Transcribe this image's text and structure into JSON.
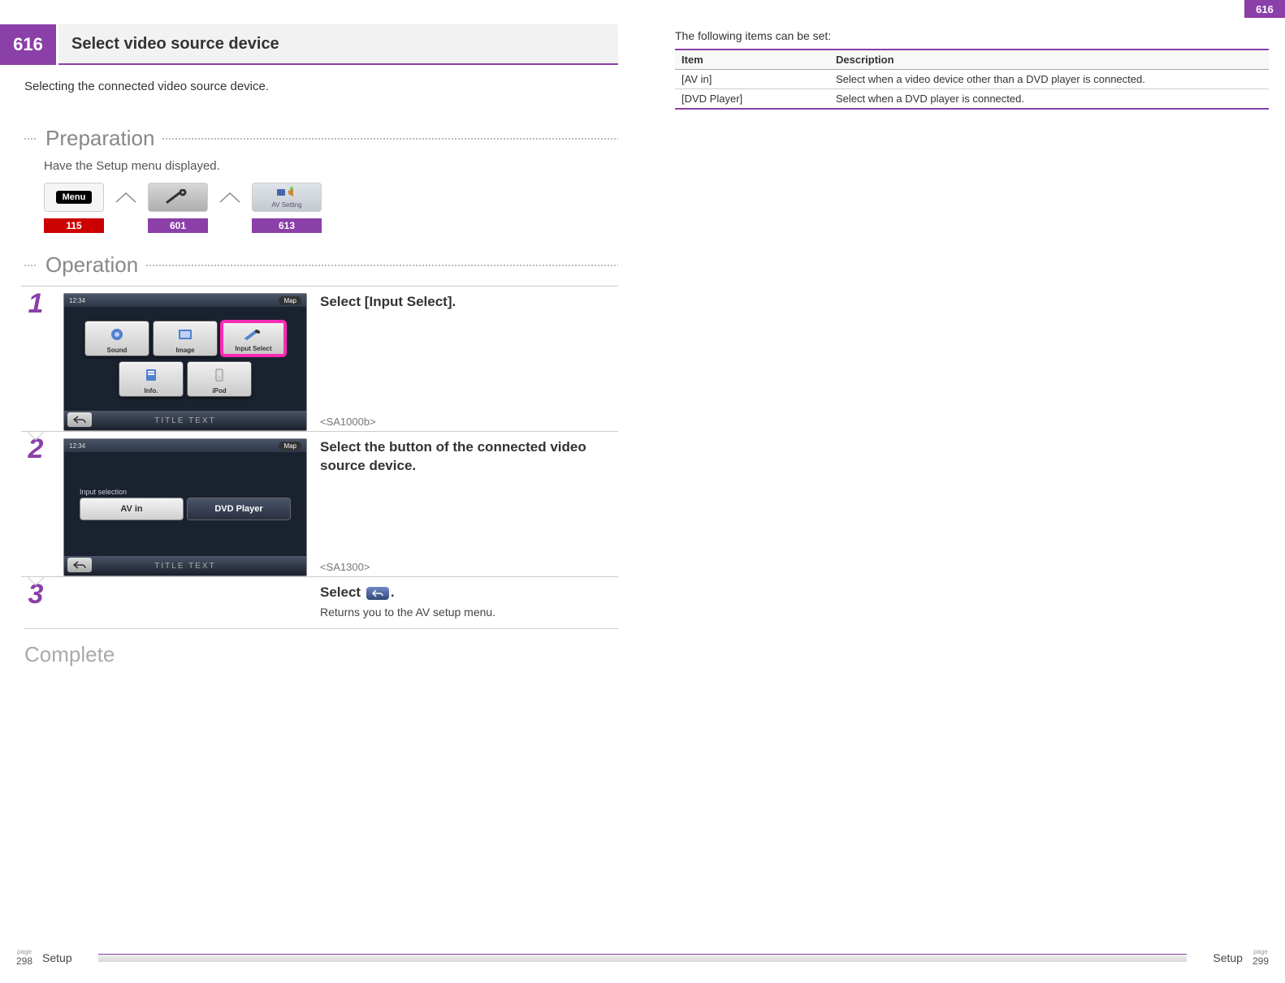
{
  "top_tab": "616",
  "header": {
    "num": "616",
    "title": "Select video source device"
  },
  "subtitle": "Selecting the connected video source device.",
  "sections": {
    "preparation": "Preparation",
    "operation": "Operation",
    "complete": "Complete"
  },
  "prep": {
    "text": "Have the Setup menu displayed.",
    "menu_label": "Menu",
    "av_label": "AV Setting",
    "refs": [
      "115",
      "601",
      "613"
    ]
  },
  "steps": [
    {
      "num": "1",
      "title": "Select [Input Select].",
      "code": "<SA1000b>",
      "shot": {
        "time": "12:34",
        "map": "Map",
        "buttons_row1": [
          "Sound",
          "Image",
          "Input Select"
        ],
        "buttons_row2": [
          "Info.",
          "iPod"
        ],
        "highlight_index": 2,
        "footer": "TITLE TEXT"
      }
    },
    {
      "num": "2",
      "title": "Select the button of the connected video source device.",
      "code": "<SA1300>",
      "shot": {
        "time": "12:34",
        "map": "Map",
        "sel_label": "Input selection",
        "sel_buttons": [
          "AV in",
          "DVD Player"
        ],
        "footer": "TITLE TEXT"
      }
    },
    {
      "num": "3",
      "title_pre": "Select ",
      "title_post": ".",
      "sub": "Returns you to the AV setup menu."
    }
  ],
  "right": {
    "intro": "The following items can be set:",
    "thead": [
      "Item",
      "Description"
    ],
    "rows": [
      [
        "[AV in]",
        "Select when a video device other than a DVD player is connected."
      ],
      [
        "[DVD Player]",
        "Select when a DVD player is connected."
      ]
    ]
  },
  "footer": {
    "page_left_label": "page",
    "page_left": "298",
    "page_right_label": "page",
    "page_right": "299",
    "section": "Setup"
  }
}
